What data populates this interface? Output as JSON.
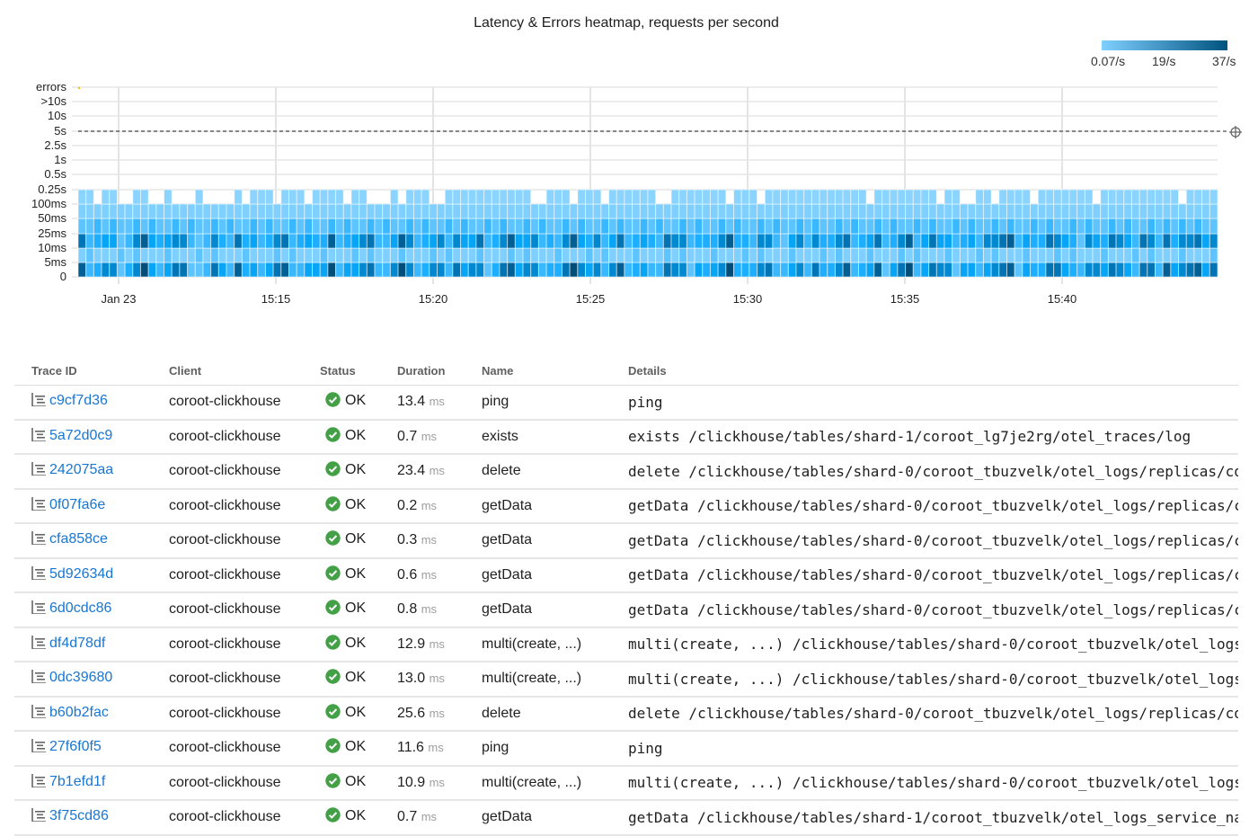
{
  "chart_data": {
    "type": "heatmap",
    "title": "Latency & Errors heatmap, requests per second",
    "legend": {
      "min_label": "0.07/s",
      "mid_label": "19/s",
      "max_label": "37/s",
      "placement": "top-right",
      "color_from": "#7fd0ff",
      "color_to": "#00527f"
    },
    "y_buckets": [
      "0",
      "5ms",
      "10ms",
      "25ms",
      "50ms",
      "100ms",
      "0.25s",
      "0.5s",
      "1s",
      "2.5s",
      "5s",
      "10s",
      ">10s",
      "errors"
    ],
    "x_tick_labels": [
      "Jan 23",
      "15:15",
      "15:20",
      "15:25",
      "15:30",
      "15:35",
      "15:40"
    ],
    "x_start": "15:08:45",
    "x_step_seconds": 15,
    "columns": 146,
    "slo_line": "5s",
    "grid": true,
    "level_palette": [
      "#8ad4ff",
      "#7fd0ff",
      "#5ec4ff",
      "#3ab8ff",
      "#1eaeff",
      "#08a4f5",
      "#0088d0",
      "#0074b4",
      "#005f94",
      "#004d7a"
    ],
    "max_bucket": "65456446544544454444645554565465654554445466544665555555554456546554555555445655656455545655565565566455655555455445545655456656554555565555545555",
    "levels": {
      "0-5ms": "83466246953577223753845357833555935567336963466375662478566344796563683453376625456944467335637446834582579357662553567825447754366576537738567857",
      "5ms-10ms": "12111212111211121211121112121112111212111211121211121112121112111212111211121211121112121112111212111211121211121112121112111212111211121211121112",
      "10ms-25ms": "73455236854566323643745346734544834567335863456365573468556343685463573454376634446844366325636446734573468357553453667835447654265476537637466756",
      "25ms-50ms": "22323223232232322323223232232322323223232232322323223232232322323223232232322323223232232322323223232232322323223232232322323223232232322323232322",
      "50ms-100ms": 1,
      "100ms-0.25s": 0
    },
    "errors": "trace"
  },
  "table": {
    "headers": [
      "Trace ID",
      "Client",
      "Status",
      "Duration",
      "Name",
      "Details"
    ],
    "duration_unit": "ms",
    "rows": [
      {
        "id": "c9cf7d36",
        "client": "coroot-clickhouse",
        "status": "OK",
        "duration": "13.4",
        "name": "ping",
        "details": "ping"
      },
      {
        "id": "5a72d0c9",
        "client": "coroot-clickhouse",
        "status": "OK",
        "duration": "0.7",
        "name": "exists",
        "details": "exists /clickhouse/tables/shard-1/coroot_lg7je2rg/otel_traces/log"
      },
      {
        "id": "242075aa",
        "client": "coroot-clickhouse",
        "status": "OK",
        "duration": "23.4",
        "name": "delete",
        "details": "delete /clickhouse/tables/shard-0/coroot_tbuzvelk/otel_logs/replicas/co"
      },
      {
        "id": "0f07fa6e",
        "client": "coroot-clickhouse",
        "status": "OK",
        "duration": "0.2",
        "name": "getData",
        "details": "getData /clickhouse/tables/shard-0/coroot_tbuzvelk/otel_logs/replicas/c"
      },
      {
        "id": "cfa858ce",
        "client": "coroot-clickhouse",
        "status": "OK",
        "duration": "0.3",
        "name": "getData",
        "details": "getData /clickhouse/tables/shard-0/coroot_tbuzvelk/otel_logs/replicas/c"
      },
      {
        "id": "5d92634d",
        "client": "coroot-clickhouse",
        "status": "OK",
        "duration": "0.6",
        "name": "getData",
        "details": "getData /clickhouse/tables/shard-0/coroot_tbuzvelk/otel_logs/replicas/c"
      },
      {
        "id": "6d0cdc86",
        "client": "coroot-clickhouse",
        "status": "OK",
        "duration": "0.8",
        "name": "getData",
        "details": "getData /clickhouse/tables/shard-0/coroot_tbuzvelk/otel_logs/replicas/c"
      },
      {
        "id": "df4d78df",
        "client": "coroot-clickhouse",
        "status": "OK",
        "duration": "12.9",
        "name": "multi(create, ...)",
        "details": "multi(create, ...) /clickhouse/tables/shard-0/coroot_tbuzvelk/otel_logs"
      },
      {
        "id": "0dc39680",
        "client": "coroot-clickhouse",
        "status": "OK",
        "duration": "13.0",
        "name": "multi(create, ...)",
        "details": "multi(create, ...) /clickhouse/tables/shard-0/coroot_tbuzvelk/otel_logs"
      },
      {
        "id": "b60b2fac",
        "client": "coroot-clickhouse",
        "status": "OK",
        "duration": "25.6",
        "name": "delete",
        "details": "delete /clickhouse/tables/shard-0/coroot_tbuzvelk/otel_logs/replicas/co"
      },
      {
        "id": "27f6f0f5",
        "client": "coroot-clickhouse",
        "status": "OK",
        "duration": "11.6",
        "name": "ping",
        "details": "ping"
      },
      {
        "id": "7b1efd1f",
        "client": "coroot-clickhouse",
        "status": "OK",
        "duration": "10.9",
        "name": "multi(create, ...)",
        "details": "multi(create, ...) /clickhouse/tables/shard-0/coroot_tbuzvelk/otel_logs"
      },
      {
        "id": "3f75cd86",
        "client": "coroot-clickhouse",
        "status": "OK",
        "duration": "0.7",
        "name": "getData",
        "details": "getData /clickhouse/tables/shard-1/coroot_tbuzvelk/otel_logs_service_na"
      }
    ]
  },
  "colors": {
    "link": "#1976d2",
    "ok": "#43a047",
    "errors_mark": "#f5c400"
  },
  "icons": {
    "trace": "trace-waterfall-icon",
    "status_ok": "check-circle-icon",
    "crosshair": "crosshair-icon"
  }
}
